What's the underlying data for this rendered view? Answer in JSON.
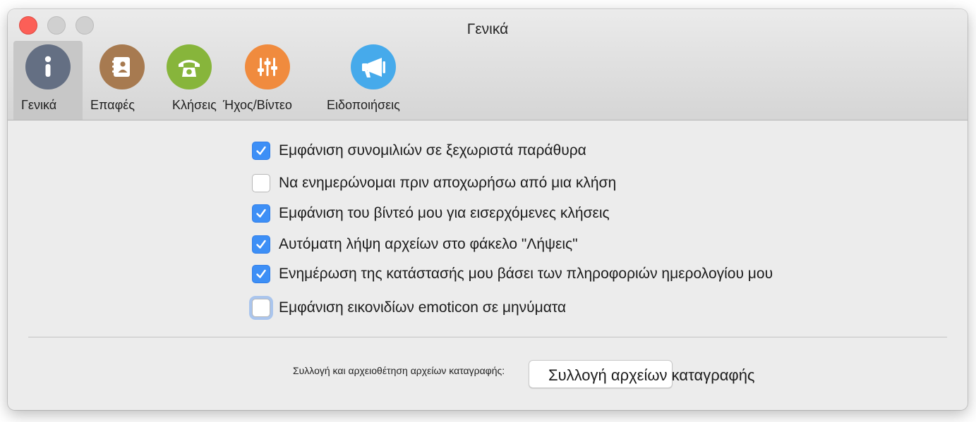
{
  "window": {
    "title": "Γενικά"
  },
  "toolbar": {
    "tabs": [
      {
        "label": "Γενικά",
        "icon": "info-icon",
        "color": "#646f83",
        "selected": true
      },
      {
        "label": "Επαφές",
        "icon": "contacts-book-icon",
        "color": "#a77a50",
        "selected": false
      },
      {
        "label": "Κλήσεις",
        "icon": "phone-icon",
        "color": "#87b53b",
        "selected": false
      },
      {
        "label": "Ήχος/Βίντεο",
        "icon": "sliders-icon",
        "color": "#f08b3e",
        "selected": false
      },
      {
        "label": "Ειδοποιήσεις",
        "icon": "megaphone-icon",
        "color": "#46aaeb",
        "selected": false
      }
    ]
  },
  "options": [
    {
      "label": "Εμφάνιση συνομιλιών σε ξεχωριστά παράθυρα",
      "checked": true
    },
    {
      "label": "Να ενημερώνομαι πριν αποχωρήσω από μια κλήση",
      "checked": false
    },
    {
      "label": "Εμφάνιση του βίντεό μου για εισερχόμενες κλήσεις",
      "checked": true
    },
    {
      "label": "Αυτόματη λήψη αρχείων στο φάκελο \"Λήψεις\"",
      "checked": true
    },
    {
      "label": "Ενημέρωση της κατάστασής μου βάσει των πληροφοριών ημερολογίου μου",
      "checked": true
    },
    {
      "label": "Εμφάνιση εικονιδίων emoticon σε μηνύματα",
      "checked": false,
      "focused": true
    }
  ],
  "footer": {
    "label": "Συλλογή και αρχειοθέτηση αρχείων καταγραφής:",
    "button_label": "Συλλογή αρχείων καταγραφής"
  },
  "colors": {
    "accent": "#3d8ff6",
    "close": "#fc5f57"
  }
}
